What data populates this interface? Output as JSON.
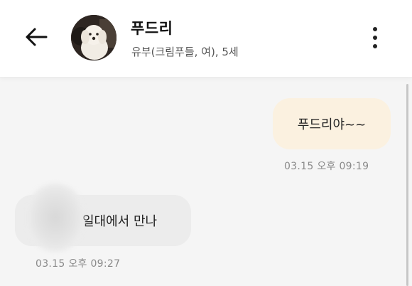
{
  "header": {
    "back_icon": "arrow-left-icon",
    "pet_name": "푸드리",
    "pet_info": "유부(크림푸들, 여), 5세",
    "more_icon": "more-vertical-icon"
  },
  "messages": [
    {
      "direction": "outgoing",
      "text": "푸드리야~~",
      "time": "03.15 오후 09:19"
    },
    {
      "direction": "incoming",
      "text": "일대에서 만나",
      "time": "03.15 오후 09:27"
    }
  ],
  "colors": {
    "outgoing_bubble": "#fbf1e0",
    "incoming_bubble": "#ececec",
    "background": "#f5f5f5",
    "header_background": "#ffffff"
  }
}
